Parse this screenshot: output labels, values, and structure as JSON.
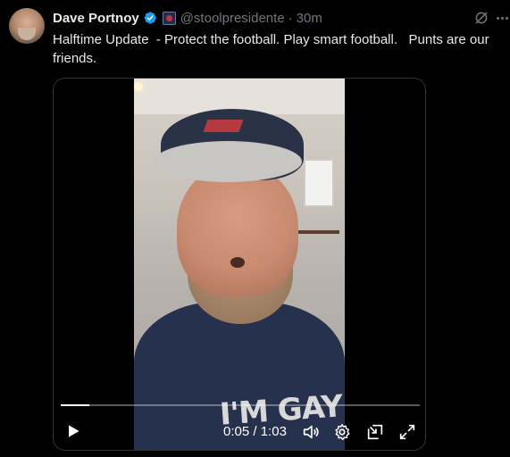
{
  "author": {
    "display_name": "Dave Portnoy",
    "handle": "@stoolpresidente",
    "time": "30m"
  },
  "tweet": {
    "text": "Halftime Update  - Protect the football. Play smart football.   Punts are our friends."
  },
  "video": {
    "current_time": "0:05",
    "duration": "1:03",
    "time_separator": " / ",
    "progress": 0.08,
    "shirt_text": "I'M GAY"
  },
  "colors": {
    "background": "#000000",
    "text_primary": "#e7e9ea",
    "text_secondary": "#71767b",
    "verified_blue": "#1d9bf0"
  },
  "icons": {
    "verified": "verified-badge-icon",
    "affiliation": "affiliation-badge-icon",
    "grok": "grok-icon",
    "more": "more-icon",
    "play": "play-icon",
    "volume": "volume-icon",
    "settings": "settings-icon",
    "pip": "picture-in-picture-icon",
    "fullscreen": "fullscreen-icon"
  }
}
